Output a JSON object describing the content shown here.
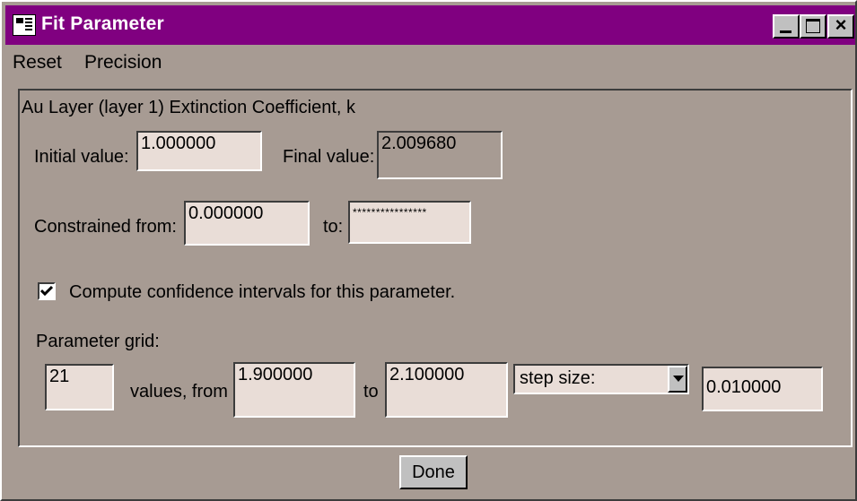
{
  "window": {
    "title": "Fit Parameter",
    "colors": {
      "titlebar": "#800080",
      "face": "#a79b93",
      "field": "#e9ddd7"
    }
  },
  "menu": {
    "reset": "Reset",
    "precision": "Precision"
  },
  "parameter": {
    "name": "Au Layer (layer 1) Extinction Coefficient, k",
    "initial_label": "Initial value:",
    "initial_value": "1.000000",
    "final_label": "Final value:",
    "final_value": "2.009680",
    "constrained_label": "Constrained from:",
    "constrained_from": "0.000000",
    "to_label": "to:",
    "constrained_to": "****************"
  },
  "confidence": {
    "checked": true,
    "label": "Compute confidence intervals for this parameter."
  },
  "grid": {
    "label": "Parameter grid:",
    "count": "21",
    "values_from_label": "values, from",
    "from": "1.900000",
    "to_label": "to",
    "to": "2.100000",
    "mode": "step size:",
    "step": "0.010000"
  },
  "done_label": "Done"
}
